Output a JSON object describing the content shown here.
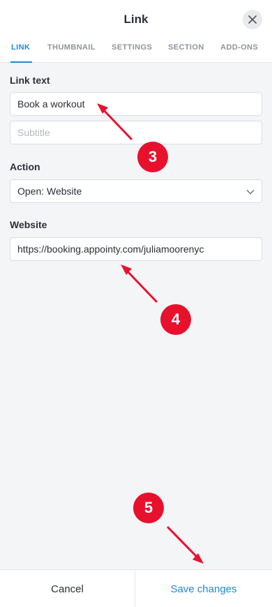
{
  "header": {
    "title": "Link"
  },
  "tabs": [
    {
      "label": "LINK",
      "active": true
    },
    {
      "label": "THUMBNAIL",
      "active": false
    },
    {
      "label": "SETTINGS",
      "active": false
    },
    {
      "label": "SECTION",
      "active": false
    },
    {
      "label": "ADD-ONS",
      "active": false
    }
  ],
  "form": {
    "link_text_label": "Link text",
    "link_text_value": "Book a workout",
    "subtitle_placeholder": "Subtitle",
    "action_label": "Action",
    "action_value": "Open: Website",
    "website_label": "Website",
    "website_value": "https://booking.appointy.com/juliamoorenyc"
  },
  "annotations": [
    "3",
    "4",
    "5"
  ],
  "footer": {
    "cancel_label": "Cancel",
    "save_label": "Save changes"
  },
  "colors": {
    "accent": "#1f8ad8",
    "annotation": "#e8112d"
  }
}
